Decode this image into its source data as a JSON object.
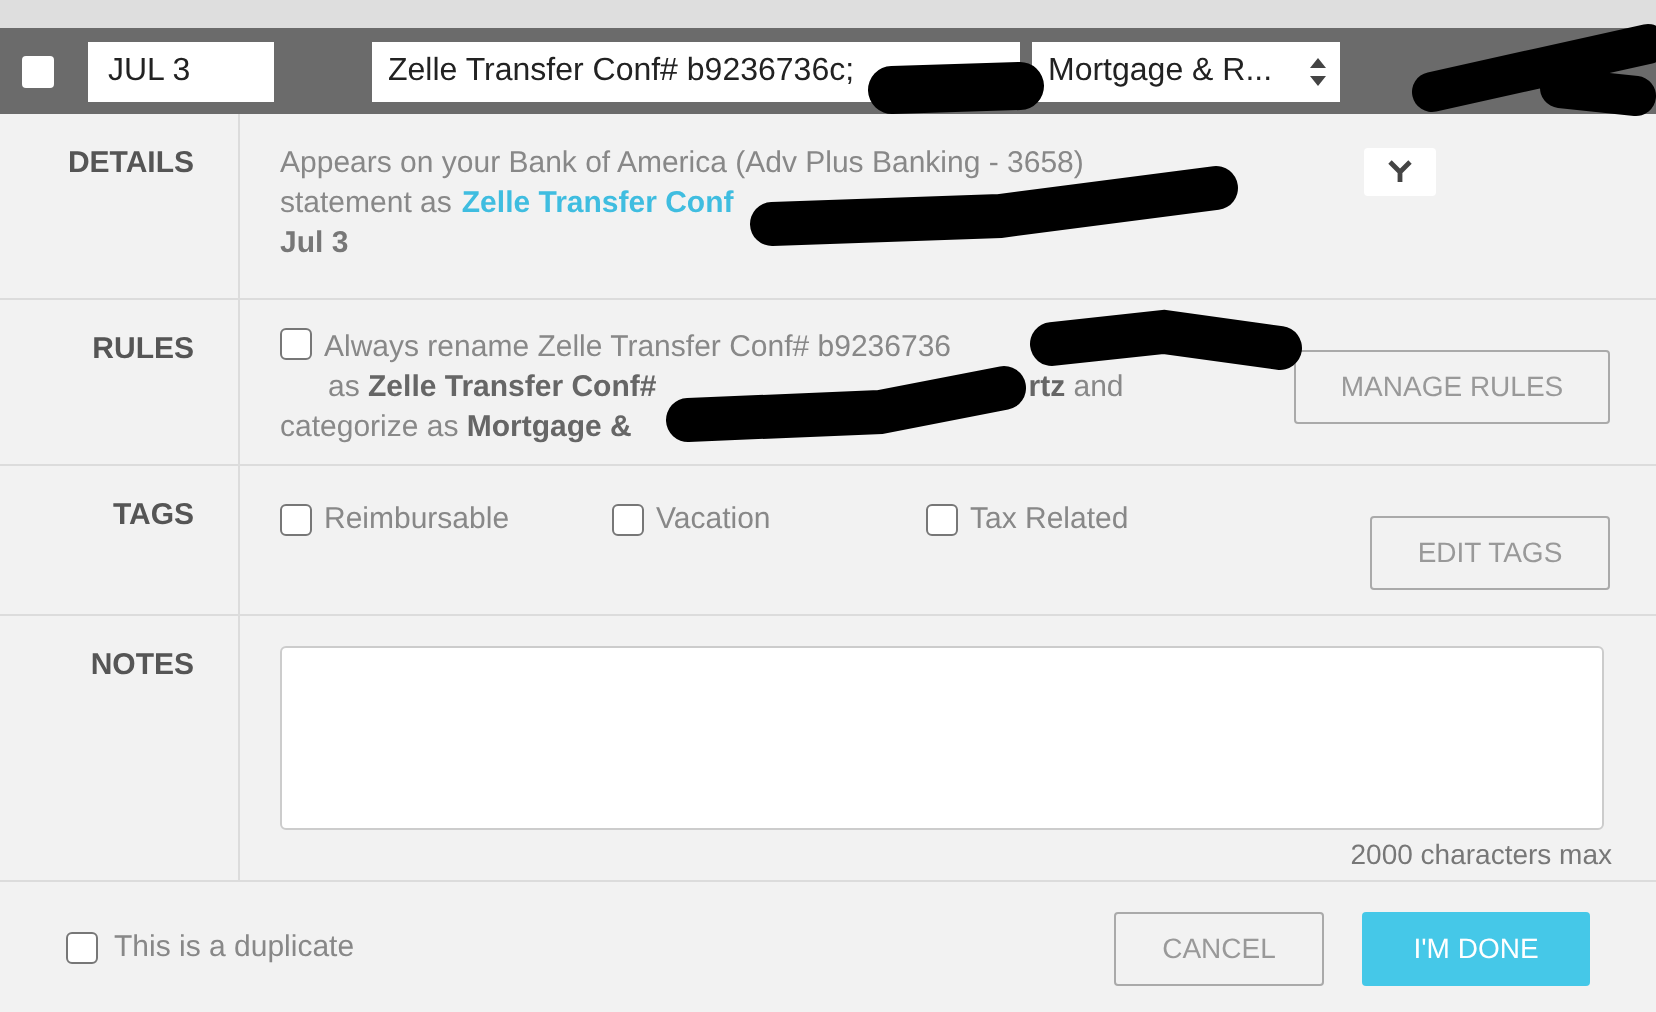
{
  "transaction": {
    "selected": false,
    "date": "JUL 3",
    "description": "Zelle Transfer Conf# b9236736c;",
    "category": "Mortgage & R..."
  },
  "details": {
    "label": "DETAILS",
    "line_1": "Appears on your Bank of America (Adv Plus Banking - 3658)",
    "line_2_prefix": "statement as",
    "link": "Zelle Transfer Conf",
    "date": "Jul 3"
  },
  "rules": {
    "label": "RULES",
    "checked": false,
    "line_1": "Always rename Zelle Transfer Conf# b9236736",
    "line_2_start": "as **Zelle Transfer Conf#**",
    "line_2_end": "**rtz** and",
    "line_3": "categorize as **Mortgage &**",
    "button": "MANAGE RULES"
  },
  "tags": {
    "label": "TAGS",
    "items": [
      {
        "label": "Reimbursable",
        "checked": false
      },
      {
        "label": "Vacation",
        "checked": false
      },
      {
        "label": "Tax Related",
        "checked": false
      }
    ],
    "button": "EDIT TAGS"
  },
  "notes": {
    "label": "NOTES",
    "counter": "2000 characters max"
  },
  "footer": {
    "duplicate": {
      "label": "This is a duplicate",
      "checked": false
    },
    "cancel": "CANCEL",
    "done": "I'M DONE"
  }
}
